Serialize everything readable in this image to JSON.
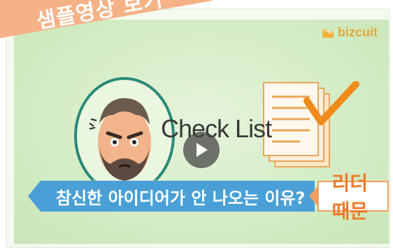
{
  "watermark": {
    "text": "샘플영상 보기"
  },
  "brand": {
    "name": "bizcuit"
  },
  "video": {
    "title": "Check List",
    "caption": "참신한 아이디어가 안 나오는 이유?",
    "answer": "리더 때문"
  },
  "colors": {
    "ribbon": "#f5b287",
    "background": "#d3ecc4",
    "caption_bg": "#4aa0d6",
    "answer_text": "#ef7b2b",
    "brand": "#e0a93a"
  }
}
